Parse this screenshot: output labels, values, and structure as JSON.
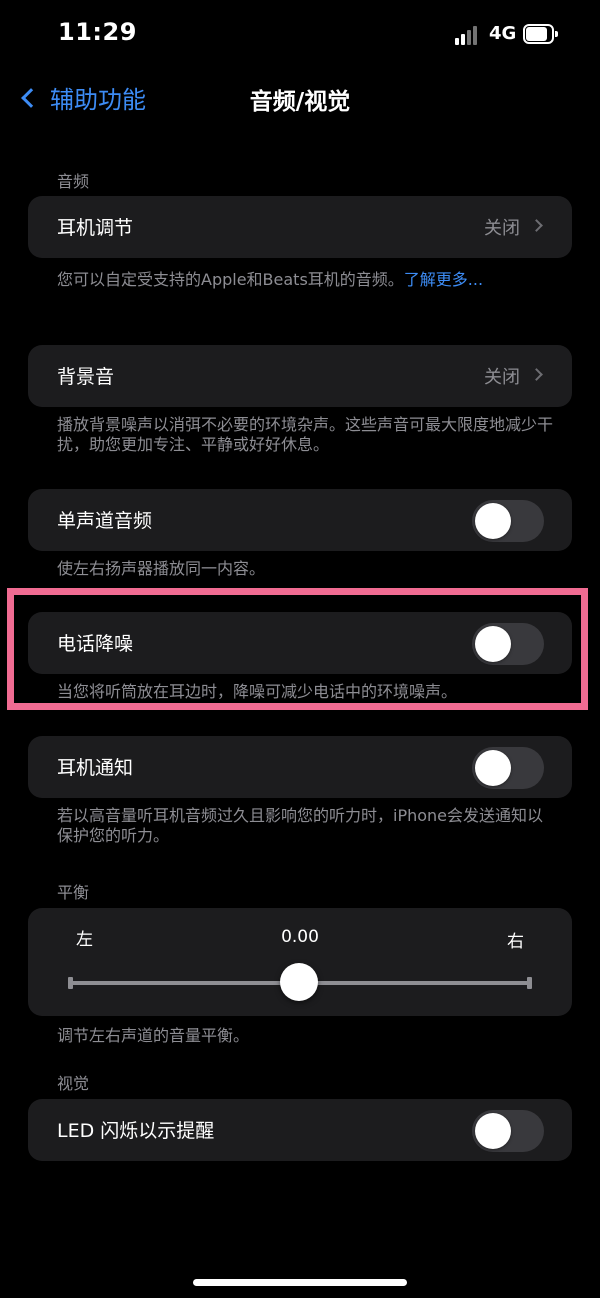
{
  "status_bar": {
    "time": "11:29",
    "network": "4G"
  },
  "nav": {
    "back_label": "辅助功能",
    "title": "音频/视觉"
  },
  "audio": {
    "header": "音频",
    "headphone_accommodations": {
      "label": "耳机调节",
      "value": "关闭"
    },
    "headphone_footer": "您可以自定受支持的Apple和Beats耳机的音频。",
    "headphone_footer_link": "了解更多..."
  },
  "background_sounds": {
    "label": "背景音",
    "value": "关闭",
    "footer": "播放背景噪声以消弭不必要的环境杂声。这些声音可最大限度地减少干扰，助您更加专注、平静或好好休息。"
  },
  "mono_audio": {
    "label": "单声道音频",
    "enabled": false,
    "footer": "使左右扬声器播放同一内容。"
  },
  "phone_noise_cancellation": {
    "label": "电话降噪",
    "enabled": false,
    "footer": "当您将听筒放在耳边时，降噪可减少电话中的环境噪声。"
  },
  "headphone_notifications": {
    "label": "耳机通知",
    "enabled": false,
    "footer": "若以高音量听耳机音频过久且影响您的听力时，iPhone会发送通知以保护您的听力。"
  },
  "balance": {
    "header": "平衡",
    "left_label": "左",
    "right_label": "右",
    "value": "0.00",
    "footer": "调节左右声道的音量平衡。"
  },
  "visual": {
    "header": "视觉",
    "led_flash": {
      "label": "LED 闪烁以示提醒",
      "enabled": false
    }
  },
  "colors": {
    "accent": "#3d8cf5",
    "highlight_border": "#f06b92",
    "cell_background": "#1c1c1e"
  }
}
